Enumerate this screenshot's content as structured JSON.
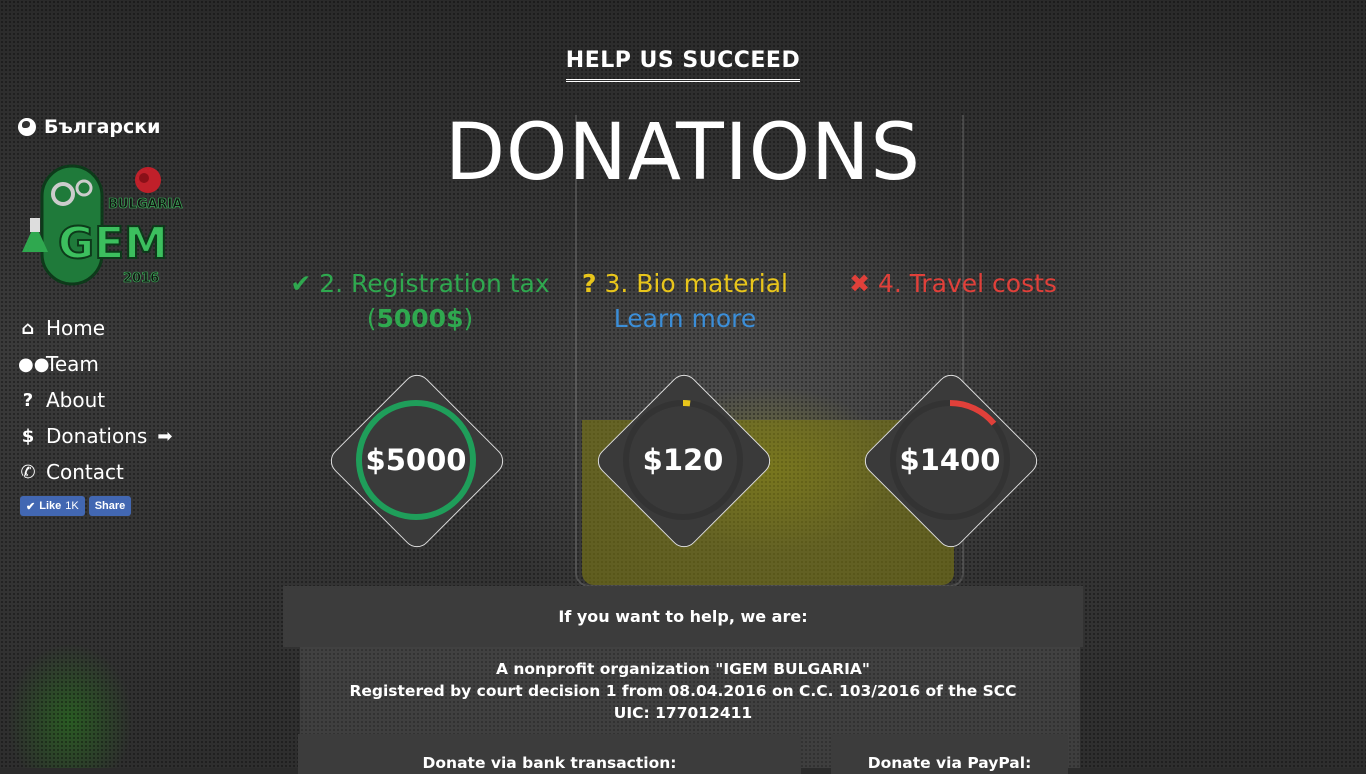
{
  "sidebar": {
    "language": "Български",
    "logo": {
      "main_text": "iGEM",
      "tag": "BULGARIA",
      "year": "2016"
    },
    "nav": [
      {
        "label": "Home",
        "icon": "home-icon",
        "glyph": "⌂"
      },
      {
        "label": "Team",
        "icon": "team-icon",
        "glyph": "👥"
      },
      {
        "label": "About",
        "icon": "question-icon",
        "glyph": "?"
      },
      {
        "label": "Donations",
        "icon": "dollar-icon",
        "glyph": "$",
        "active": true
      },
      {
        "label": "Contact",
        "icon": "phone-icon",
        "glyph": "✆"
      }
    ],
    "facebook": {
      "like_label": "Like",
      "like_count": "1K",
      "share_label": "Share"
    }
  },
  "header": {
    "subtitle": "HELP US SUCCEED",
    "title": "DONATIONS"
  },
  "steps": [
    {
      "status": "done",
      "icon": "check-icon",
      "glyph": "✔",
      "label": "2. Registration tax",
      "extra_open": "(",
      "amount": "5000$",
      "extra_close": ")",
      "color": "#2fa84f"
    },
    {
      "status": "pending",
      "icon": "question-icon",
      "glyph": "?",
      "label": "3. Bio material",
      "link": "Learn more",
      "color": "#e8c51b"
    },
    {
      "status": "failed",
      "icon": "cross-icon",
      "glyph": "✖",
      "label": "4. Travel costs",
      "color": "#e0403a"
    }
  ],
  "goals": [
    {
      "amount": "$5000",
      "progress": 1.0,
      "color": "#1f9e5a"
    },
    {
      "amount": "$120",
      "progress": 0.02,
      "color": "#e8c51b"
    },
    {
      "amount": "$1400",
      "progress": 0.14,
      "color": "#e0403a"
    }
  ],
  "info": {
    "help_heading": "If you want to help, we are:",
    "org_line1": "A nonprofit organization \"IGEM BULGARIA\"",
    "org_line2": "Registered by court decision 1 from 08.04.2016 on C.C. 103/2016 of the SCC",
    "org_line3": "UIC: 177012411",
    "bank_heading": "Donate via bank transaction:",
    "paypal_heading": "Donate via PayPal:"
  },
  "colors": {
    "done": "#2fa84f",
    "pending": "#e8c51b",
    "failed": "#e0403a",
    "link": "#3b8ed8",
    "panel": "#3c3c3c"
  }
}
